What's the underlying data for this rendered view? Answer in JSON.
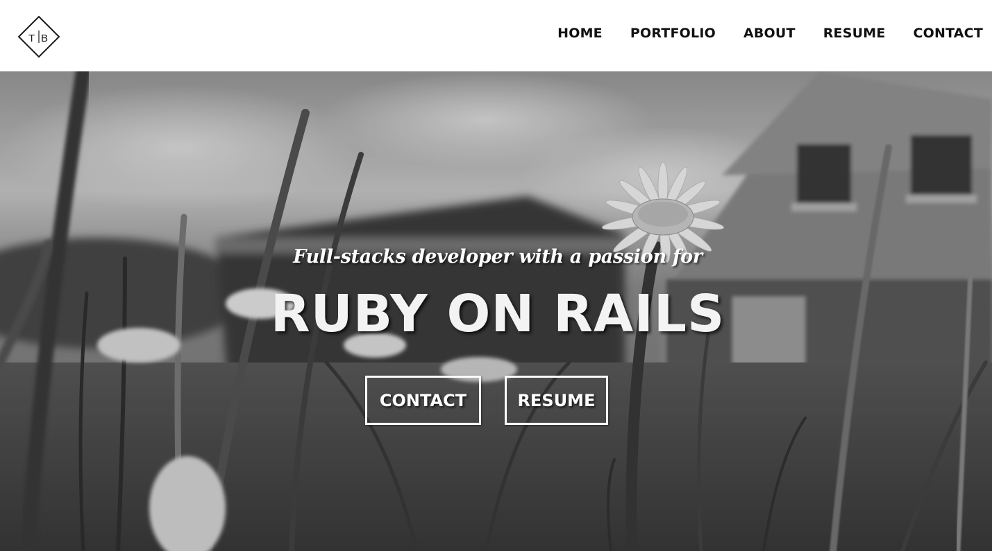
{
  "header": {
    "logo": {
      "icon": "diamond-monogram-logo",
      "letters": "TB"
    },
    "nav": [
      {
        "label": "HOME"
      },
      {
        "label": "PORTFOLIO"
      },
      {
        "label": "ABOUT"
      },
      {
        "label": "RESUME"
      },
      {
        "label": "CONTACT"
      }
    ]
  },
  "hero": {
    "background": "black-and-white photo of daisies in grass in front of a house",
    "tagline": "Full-stacks developer with a passion for",
    "headline": "RUBY ON RAILS",
    "buttons": {
      "contact": "CONTACT",
      "resume": "RESUME"
    }
  },
  "colors": {
    "header_bg": "#ffffff",
    "nav_text": "#111111",
    "hero_text": "#ffffff"
  }
}
